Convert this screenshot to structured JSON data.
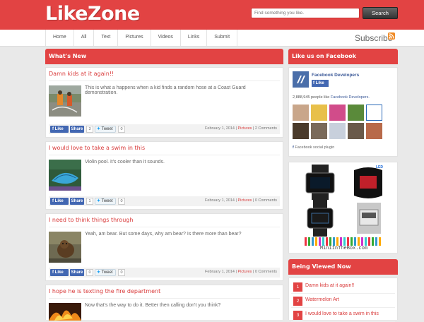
{
  "header": {
    "logo": "LikeZone",
    "search_placeholder": "Find something you like.",
    "search_button": "Search"
  },
  "nav": {
    "items": [
      "Home",
      "All",
      "Text",
      "Pictures",
      "Videos",
      "Links",
      "Submit"
    ],
    "subscribe": "Subscribe",
    "rss_icon": "rss-icon"
  },
  "main": {
    "section_title": "What's New",
    "posts": [
      {
        "title": "Damn kids at it again!!",
        "text": "This is what a happens when a kid finds a random hose at a Coast Guard demonstration.",
        "share_count": "3",
        "tweet_count": "0",
        "date": "February 1, 2014",
        "category": "Pictures",
        "comments": "2 Comments"
      },
      {
        "title": "I would love to take a swim in this",
        "text": "Violin pool. it's cooler than it sounds.",
        "share_count": "1",
        "tweet_count": "0",
        "date": "February 1, 2014",
        "category": "Pictures",
        "comments": "0 Comments"
      },
      {
        "title": "I need to think things through",
        "text": "Yeah, am bear. But some days, why am bear? Is there more than bear?",
        "share_count": "0",
        "tweet_count": "0",
        "date": "February 1, 2014",
        "category": "Pictures",
        "comments": "0 Comments"
      },
      {
        "title": "I hope he is texting the fire department",
        "text": "Now that's the way to do it. Better then calling don't you think?"
      }
    ],
    "like_label": "Like",
    "share_label": "Share",
    "tweet_label": "Tweet",
    "separator": "|"
  },
  "sidebar": {
    "facebook": {
      "title": "Like us on Facebook",
      "page_name": "Facebook Developers",
      "like_label": "Like",
      "count_text": "2,888,945 people like",
      "count_link": "Facebook Developers.",
      "plugin_label": "Facebook social plugin"
    },
    "ad": {
      "site": "MiniInTheBox.com",
      "watch_label": "LED"
    },
    "being_viewed": {
      "title": "Being Viewed Now",
      "items": [
        {
          "rank": "1",
          "label": "Damn kids at it again!!"
        },
        {
          "rank": "2",
          "label": "Watermelon Art"
        },
        {
          "rank": "3",
          "label": "I would love to take a swim in this"
        }
      ]
    }
  },
  "colors": {
    "brand_red": "#e24343",
    "link_red": "#d93b3b",
    "facebook_blue": "#4267b2"
  }
}
